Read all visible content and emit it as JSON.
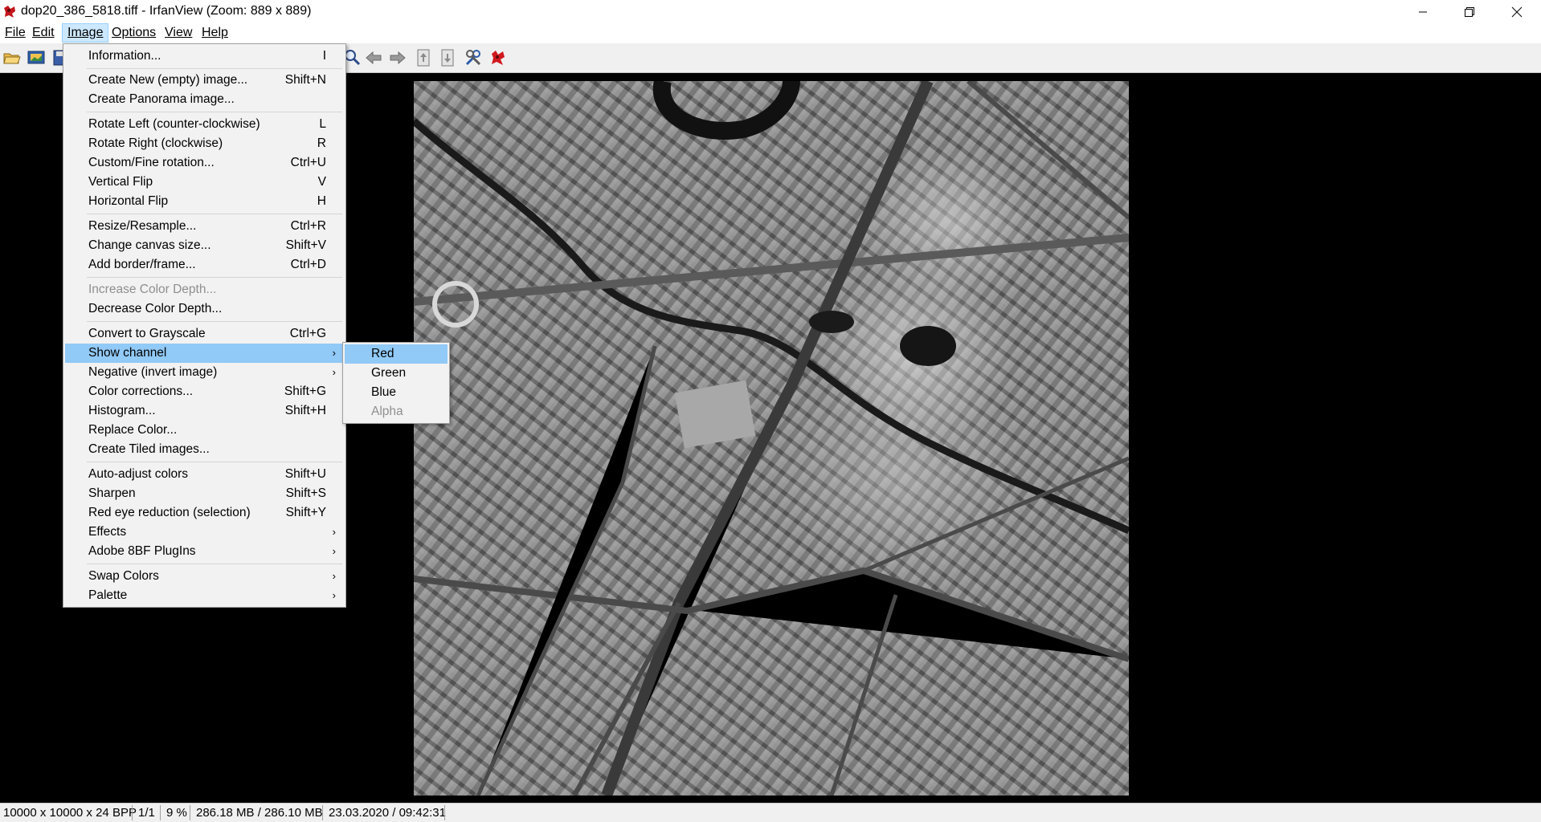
{
  "window": {
    "title": "dop20_386_5818.tiff - IrfanView (Zoom: 889 x 889)",
    "controls": {
      "minimize": "—",
      "restore": "❐",
      "close": "✕"
    }
  },
  "menubar": {
    "items": [
      {
        "label": "File",
        "active": false
      },
      {
        "label": "Edit",
        "active": false
      },
      {
        "label": "Image",
        "active": true
      },
      {
        "label": "Options",
        "active": false
      },
      {
        "label": "View",
        "active": false
      },
      {
        "label": "Help",
        "active": false
      }
    ]
  },
  "toolbar": {
    "icons": [
      "open-folder-icon",
      "slideshow-icon",
      "save-icon",
      "zoom-icon",
      "previous-arrow-icon",
      "next-arrow-icon",
      "first-file-icon",
      "last-file-icon",
      "properties-tools-icon",
      "irfanview-logo-icon"
    ]
  },
  "image_menu": {
    "items": [
      {
        "label": "Information...",
        "shortcut": "I"
      },
      {
        "label": "Create New (empty) image...",
        "shortcut": "Shift+N"
      },
      {
        "label": "Create Panorama image...",
        "shortcut": ""
      },
      {
        "label": "Rotate Left (counter-clockwise)",
        "shortcut": "L"
      },
      {
        "label": "Rotate Right (clockwise)",
        "shortcut": "R"
      },
      {
        "label": "Custom/Fine rotation...",
        "shortcut": "Ctrl+U"
      },
      {
        "label": "Vertical Flip",
        "shortcut": "V"
      },
      {
        "label": "Horizontal Flip",
        "shortcut": "H"
      },
      {
        "label": "Resize/Resample...",
        "shortcut": "Ctrl+R"
      },
      {
        "label": "Change canvas size...",
        "shortcut": "Shift+V"
      },
      {
        "label": "Add border/frame...",
        "shortcut": "Ctrl+D"
      },
      {
        "label": "Increase Color Depth...",
        "shortcut": "",
        "disabled": true
      },
      {
        "label": "Decrease Color Depth...",
        "shortcut": ""
      },
      {
        "label": "Convert to Grayscale",
        "shortcut": "Ctrl+G"
      },
      {
        "label": "Show channel",
        "shortcut": "",
        "submenu": true,
        "highlighted": true
      },
      {
        "label": "Negative (invert image)",
        "shortcut": "",
        "submenu": true
      },
      {
        "label": "Color corrections...",
        "shortcut": "Shift+G"
      },
      {
        "label": "Histogram...",
        "shortcut": "Shift+H"
      },
      {
        "label": "Replace Color...",
        "shortcut": ""
      },
      {
        "label": "Create Tiled images...",
        "shortcut": ""
      },
      {
        "label": "Auto-adjust colors",
        "shortcut": "Shift+U"
      },
      {
        "label": "Sharpen",
        "shortcut": "Shift+S"
      },
      {
        "label": "Red eye reduction (selection)",
        "shortcut": "Shift+Y"
      },
      {
        "label": "Effects",
        "shortcut": "",
        "submenu": true
      },
      {
        "label": "Adobe 8BF PlugIns",
        "shortcut": "",
        "submenu": true
      },
      {
        "label": "Swap Colors",
        "shortcut": "",
        "submenu": true
      },
      {
        "label": "Palette",
        "shortcut": "",
        "submenu": true
      }
    ]
  },
  "channel_submenu": {
    "items": [
      {
        "label": "Red",
        "highlighted": true
      },
      {
        "label": "Green"
      },
      {
        "label": "Blue"
      },
      {
        "label": "Alpha",
        "disabled": true
      }
    ]
  },
  "statusbar": {
    "dimensions": "10000 x 10000 x 24 BPP",
    "index": "1/1",
    "zoom": "9 %",
    "memory": "286.18 MB / 286.10 MB",
    "datetime": "23.03.2020 / 09:42:31"
  },
  "colors": {
    "menu_highlight": "#91c9f7",
    "active_menubar": "#cce8ff",
    "viewport_bg": "#000000"
  }
}
